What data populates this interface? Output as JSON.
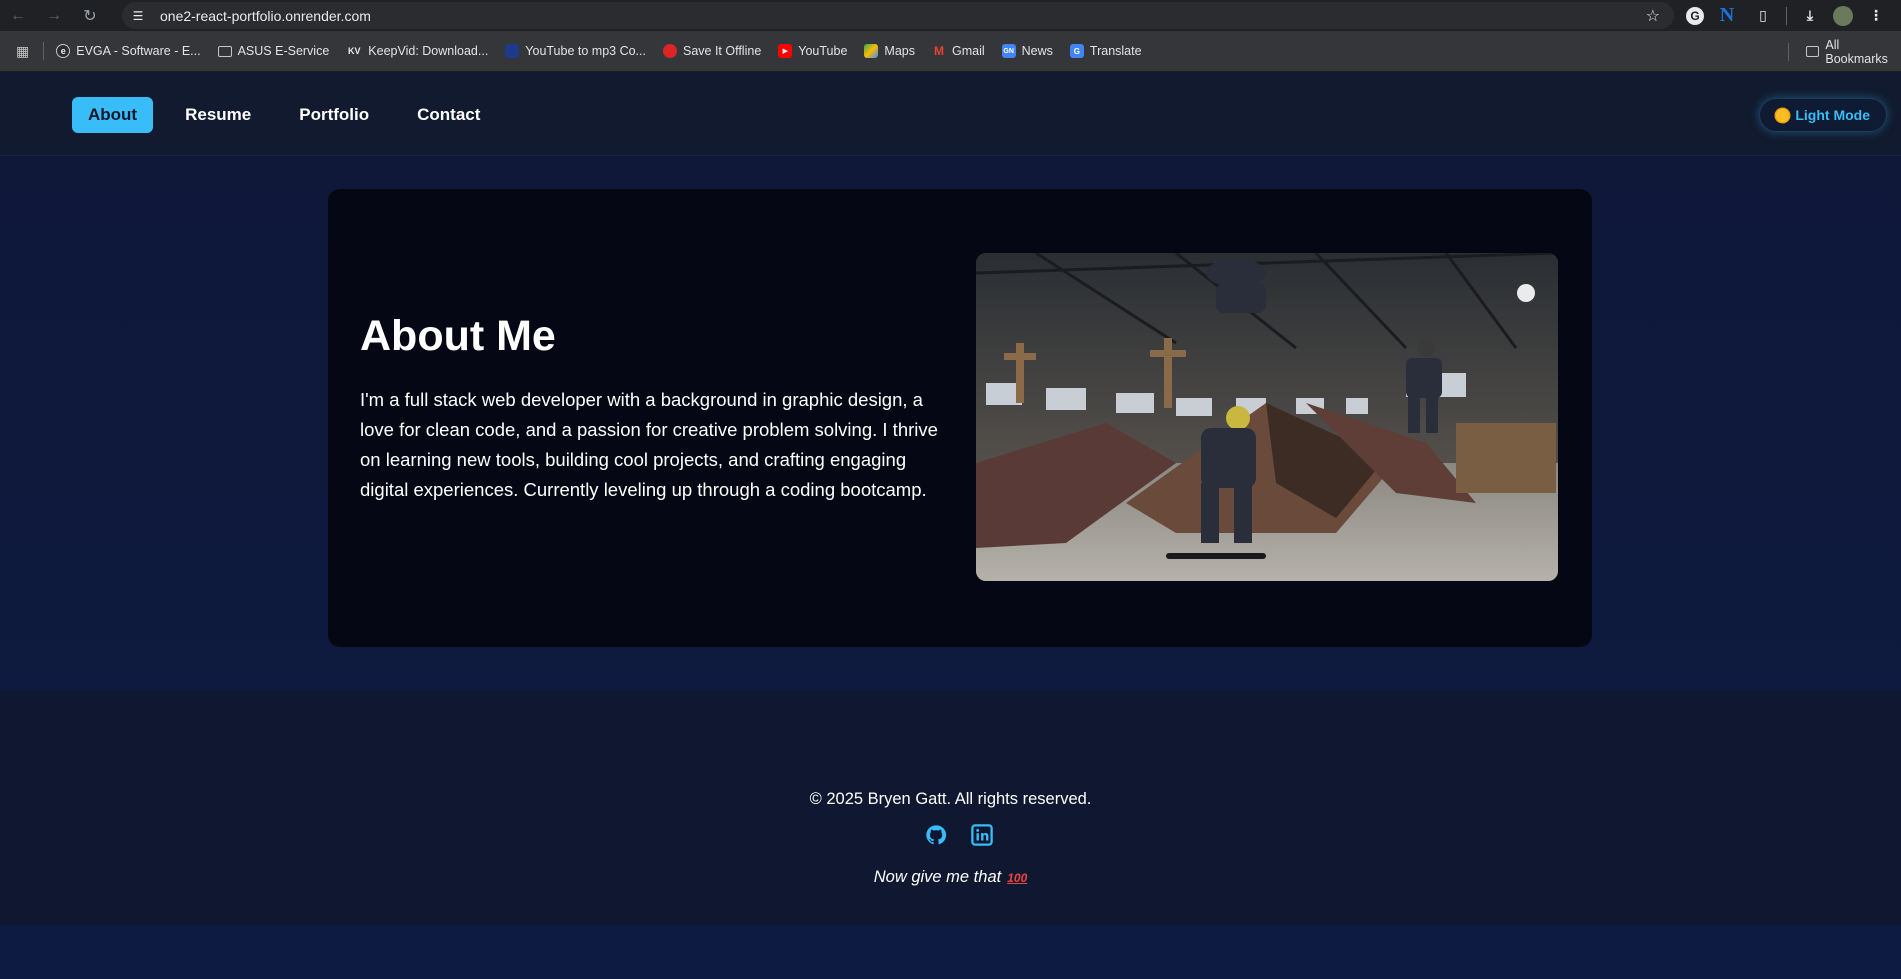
{
  "browser": {
    "url": "one2-react-portfolio.onrender.com",
    "bookmarks": [
      {
        "label": "EVGA - Software - E...",
        "icon": "evga-icon"
      },
      {
        "label": "ASUS E-Service",
        "icon": "folder-icon"
      },
      {
        "label": "KeepVid: Download...",
        "icon": "keepvid-icon"
      },
      {
        "label": "YouTube to mp3 Co...",
        "icon": "converter-icon"
      },
      {
        "label": "Save It Offline",
        "icon": "save-it-offline-icon"
      },
      {
        "label": "YouTube",
        "icon": "youtube-icon"
      },
      {
        "label": "Maps",
        "icon": "maps-icon"
      },
      {
        "label": "Gmail",
        "icon": "gmail-icon"
      },
      {
        "label": "News",
        "icon": "news-icon"
      },
      {
        "label": "Translate",
        "icon": "translate-icon"
      }
    ],
    "all_bookmarks_label": "All Bookmarks"
  },
  "nav": {
    "items": [
      {
        "label": "About",
        "active": true
      },
      {
        "label": "Resume",
        "active": false
      },
      {
        "label": "Portfolio",
        "active": false
      },
      {
        "label": "Contact",
        "active": false
      }
    ],
    "theme_toggle_label": "Light Mode"
  },
  "about": {
    "title": "About Me",
    "body": "I'm a full stack web developer with a background in graphic design, a love for clean code, and a passion for creative problem solving. I thrive on learning new tools, building cool projects, and crafting engaging digital experiences. Currently leveling up through a coding bootcamp."
  },
  "footer": {
    "copyright": "© 2025 Bryen Gatt. All rights reserved.",
    "tagline": "Now give me that",
    "emoji": "100"
  },
  "colors": {
    "accent": "#38bdf8",
    "card": "#050814",
    "header": "#111a2e"
  }
}
